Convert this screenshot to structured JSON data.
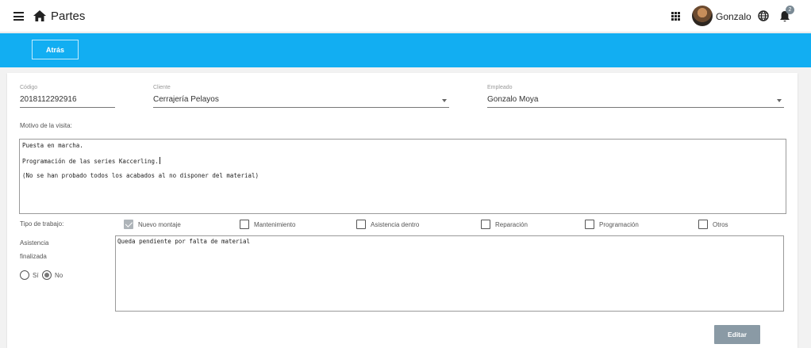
{
  "header": {
    "title": "Partes",
    "user_name": "Gonzalo",
    "notification_count": "2",
    "icons": [
      "hamburger-menu-icon",
      "home-icon",
      "apps-grid-icon",
      "globe-icon",
      "bell-icon"
    ]
  },
  "toolbar": {
    "back_label": "Atrás"
  },
  "form": {
    "codigo": {
      "label": "Código",
      "value": "2018112292916"
    },
    "cliente": {
      "label": "Cliente",
      "value": "Cerrajería Pelayos"
    },
    "empleado": {
      "label": "Empleado",
      "value": "Gonzalo Moya"
    },
    "motivo": {
      "label": "Motivo de la visita:",
      "lines": [
        "Puesta en marcha.",
        "Programación de las series Kaccerling.",
        "(No se han probado todos los acabados al no disponer del material)"
      ]
    },
    "tipo_trabajo": {
      "label": "Tipo de trabajo:",
      "options": [
        {
          "label": "Nuevo montaje",
          "checked": true
        },
        {
          "label": "Mantenimiento",
          "checked": false
        },
        {
          "label": "Asistencia dentro",
          "checked": false
        },
        {
          "label": "Reparación",
          "checked": false
        },
        {
          "label": "Programación",
          "checked": false
        },
        {
          "label": "Otros",
          "checked": false
        }
      ]
    },
    "asistencia": {
      "label_line1": "Asistencia",
      "label_line2": "finalizada",
      "options": [
        {
          "label": "Sí",
          "checked": false
        },
        {
          "label": "No",
          "checked": true
        }
      ],
      "notes": "Queda pendiente por falta de material"
    },
    "edit_label": "Editar"
  },
  "colors": {
    "accent_bar": "#12aef2",
    "edit_button": "#8a9aa5",
    "checkbox_checked": "#aeb4b9"
  }
}
